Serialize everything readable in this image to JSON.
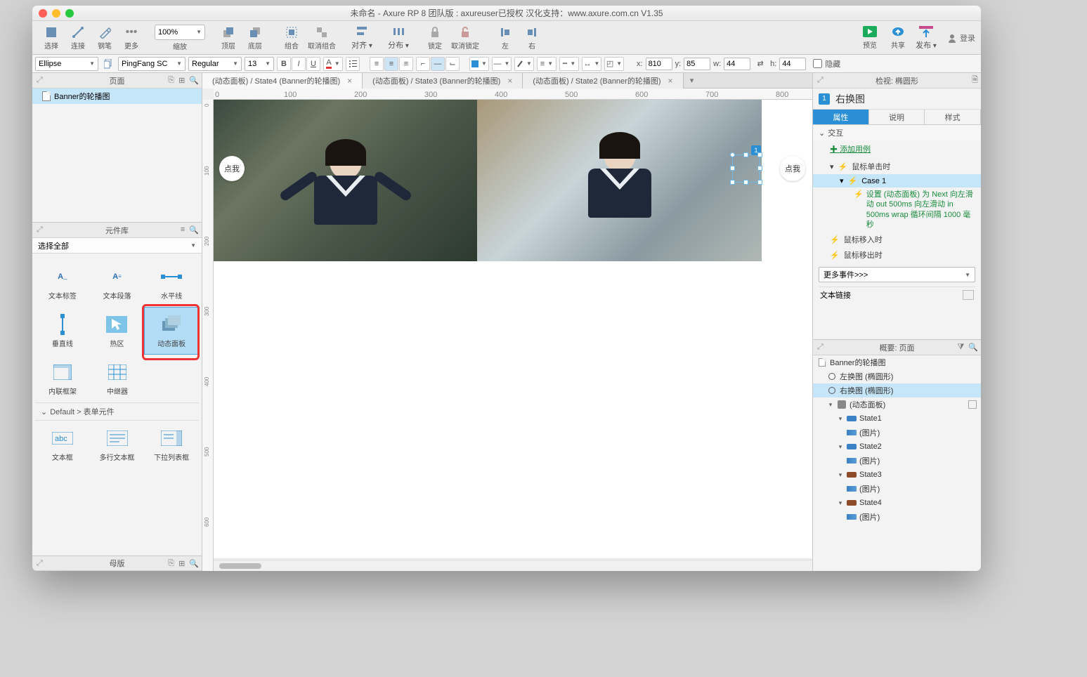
{
  "title": "未命名 - Axure RP 8 团队版 : axureuser已授权 汉化支持：www.axure.com.cn V1.35",
  "toolbar": {
    "select": "选择",
    "connect": "连接",
    "pen": "钢笔",
    "more": "更多",
    "zoom": "100%",
    "zoom_label": "缩放",
    "front": "顶层",
    "back": "底层",
    "group": "组合",
    "ungroup": "取消组合",
    "align": "对齐",
    "distribute": "分布",
    "lock": "锁定",
    "unlock": "取消锁定",
    "alignleft": "左",
    "alignright": "右",
    "preview": "预览",
    "share": "共享",
    "publish": "发布",
    "login": "登录"
  },
  "fmt": {
    "shape": "Ellipse",
    "font": "PingFang SC",
    "weight": "Regular",
    "size": "13",
    "x_label": "x:",
    "x": "810",
    "y_label": "y:",
    "y": "85",
    "w_label": "w:",
    "w": "44",
    "h_label": "h:",
    "h": "44",
    "hidden_label": "隐藏"
  },
  "pages": {
    "title": "页面",
    "items": [
      "Banner的轮播图"
    ]
  },
  "library": {
    "title": "元件库",
    "select_all": "选择全部",
    "items1": [
      "文本标签",
      "文本段落",
      "水平线"
    ],
    "items2": [
      "垂直线",
      "热区",
      "动态面板"
    ],
    "items3": [
      "内联框架",
      "中继器"
    ],
    "section2": "Default > 表单元件",
    "items4": [
      "文本框",
      "多行文本框",
      "下拉列表框"
    ]
  },
  "masters": {
    "title": "母版"
  },
  "tabs": [
    "(动态面板) / State4 (Banner的轮播图)",
    "(动态面板) / State3 (Banner的轮播图)",
    "(动态面板) / State2 (Banner的轮播图)"
  ],
  "canvas": {
    "btn_text": "点我",
    "ruler_h": [
      "0",
      "100",
      "200",
      "300",
      "400",
      "500",
      "600",
      "700",
      "800"
    ],
    "ruler_v": [
      "0",
      "100",
      "200",
      "300",
      "400",
      "500",
      "600"
    ],
    "sel_badge": "1"
  },
  "inspector": {
    "hdr": "检视: 椭圆形",
    "name": "右换图",
    "tabs": [
      "属性",
      "说明",
      "样式"
    ],
    "section_interaction": "交互",
    "add_case": "添加用例",
    "events": {
      "click": "鼠标单击时",
      "case1": "Case 1",
      "action": "设置 (动态面板) 为 Next 向左滑动 out 500ms 向左滑动 in 500ms wrap 循环间隔 1000 毫秒",
      "enter": "鼠标移入时",
      "leave": "鼠标移出时"
    },
    "more_events": "更多事件>>>",
    "textlink": "文本链接"
  },
  "outline": {
    "hdr": "概要: 页面",
    "root": "Banner的轮播图",
    "left_btn": "左换图 (椭圆形)",
    "right_btn": "右换图 (椭圆形)",
    "panel": "(动态面板)",
    "states": [
      "State1",
      "State2",
      "State3",
      "State4"
    ],
    "image": "(图片)"
  }
}
